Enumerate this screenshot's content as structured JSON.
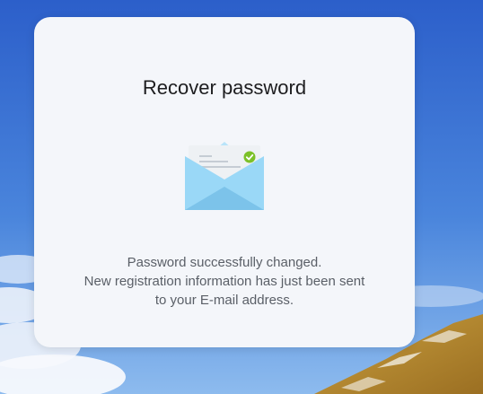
{
  "dialog": {
    "title": "Recover password",
    "illustration_icon": "envelope-success-icon",
    "message_lines": [
      "Password successfully changed.",
      "New registration information has just been sent",
      "to your E-mail address."
    ]
  },
  "colors": {
    "card_background": "#f4f6fa",
    "title_text": "#1d1d1f",
    "message_text": "#5a5f67",
    "envelope_blue": "#8ed0f3",
    "check_green": "#7cc128"
  }
}
